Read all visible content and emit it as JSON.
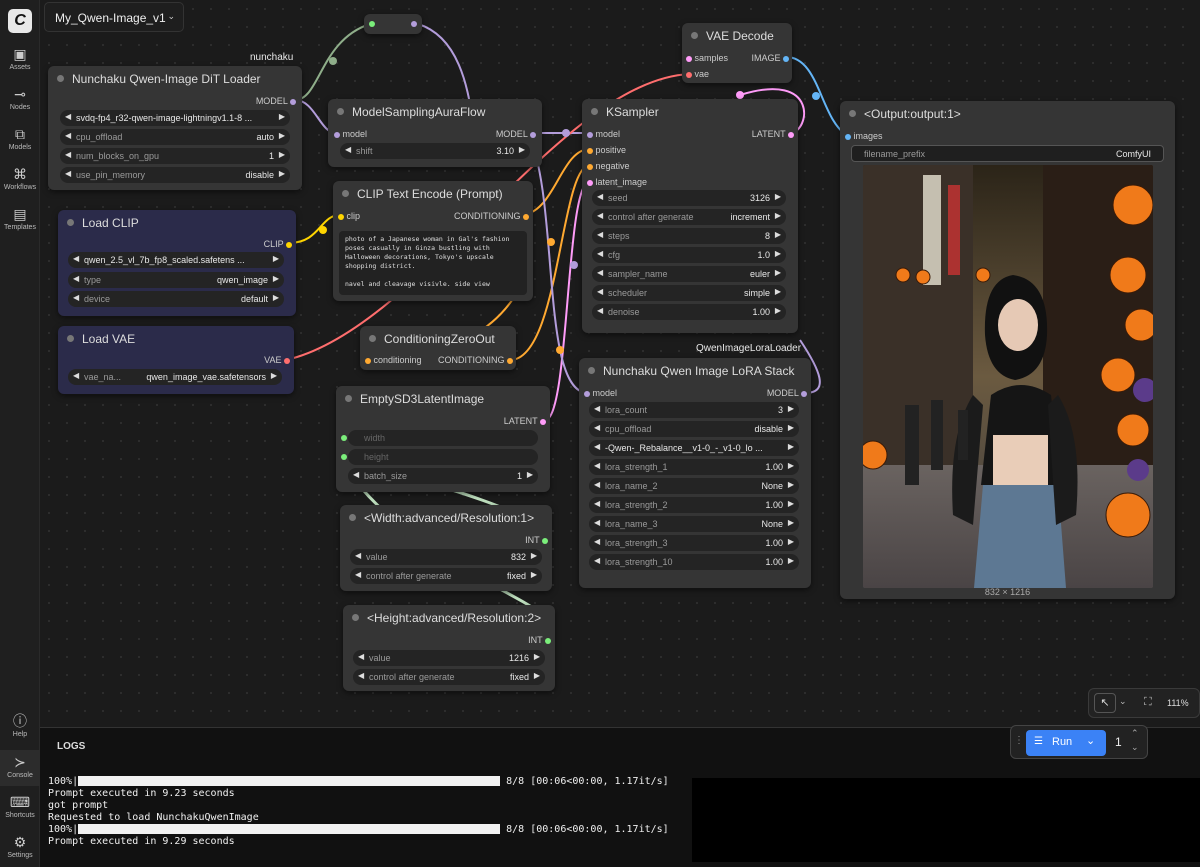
{
  "workflow_tab": {
    "title": "My_Qwen-Image_v1"
  },
  "sidebar": {
    "items": [
      {
        "label": "Assets"
      },
      {
        "label": "Nodes"
      },
      {
        "label": "Models"
      },
      {
        "label": "Workflows"
      },
      {
        "label": "Templates"
      }
    ],
    "bottom_items": [
      {
        "label": "Help"
      },
      {
        "label": "Console"
      },
      {
        "label": "Shortcuts"
      },
      {
        "label": "Settings"
      }
    ]
  },
  "group_labels": {
    "nunchaku": "nunchaku",
    "lora_loader": "QwenImageLoraLoader"
  },
  "nodes": {
    "dit_loader": {
      "title": "Nunchaku Qwen-Image DiT Loader",
      "out": "MODEL",
      "widgets": [
        {
          "label": "",
          "value": "svdq-fp4_r32-qwen-image-lightningv1.1-8 ..."
        },
        {
          "label": "cpu_offload",
          "value": "auto"
        },
        {
          "label": "num_blocks_on_gpu",
          "value": "1"
        },
        {
          "label": "use_pin_memory",
          "value": "disable"
        }
      ]
    },
    "load_clip": {
      "title": "Load CLIP",
      "out": "CLIP",
      "widgets": [
        {
          "label": "",
          "value": "qwen_2.5_vl_7b_fp8_scaled.safetens ..."
        },
        {
          "label": "type",
          "value": "qwen_image"
        },
        {
          "label": "device",
          "value": "default"
        }
      ]
    },
    "load_vae": {
      "title": "Load VAE",
      "out": "VAE",
      "widgets": [
        {
          "label": "vae_na...",
          "value": "qwen_image_vae.safetensors"
        }
      ]
    },
    "model_sampling": {
      "title": "ModelSamplingAuraFlow",
      "in": "model",
      "out": "MODEL",
      "widgets": [
        {
          "label": "shift",
          "value": "3.10"
        }
      ]
    },
    "clip_text": {
      "title": "CLIP Text Encode (Prompt)",
      "in": "clip",
      "out": "CONDITIONING",
      "text": "photo of a Japanese woman in Gal's fashion poses casually in Ginza bustling with Halloween decorations, Tokyo's upscale shopping district.\n\nnavel and cleavage visivle. side view"
    },
    "cond_zero": {
      "title": "ConditioningZeroOut",
      "in": "conditioning",
      "out": "CONDITIONING"
    },
    "empty_latent": {
      "title": "EmptySD3LatentImage",
      "out": "LATENT",
      "inputs": [
        "width",
        "height"
      ],
      "widgets": [
        {
          "label": "batch_size",
          "value": "1"
        }
      ]
    },
    "width_node": {
      "title": "<Width:advanced/Resolution:1>",
      "out": "INT",
      "widgets": [
        {
          "label": "value",
          "value": "832"
        },
        {
          "label": "control after generate",
          "value": "fixed"
        }
      ]
    },
    "height_node": {
      "title": "<Height:advanced/Resolution:2>",
      "out": "INT",
      "widgets": [
        {
          "label": "value",
          "value": "1216"
        },
        {
          "label": "control after generate",
          "value": "fixed"
        }
      ]
    },
    "vae_decode": {
      "title": "VAE Decode",
      "in1": "samples",
      "in2": "vae",
      "out": "IMAGE"
    },
    "ksampler": {
      "title": "KSampler",
      "inputs": [
        "model",
        "positive",
        "negative",
        "latent_image"
      ],
      "out": "LATENT",
      "widgets": [
        {
          "label": "seed",
          "value": "3126"
        },
        {
          "label": "control after generate",
          "value": "increment"
        },
        {
          "label": "steps",
          "value": "8"
        },
        {
          "label": "cfg",
          "value": "1.0"
        },
        {
          "label": "sampler_name",
          "value": "euler"
        },
        {
          "label": "scheduler",
          "value": "simple"
        },
        {
          "label": "denoise",
          "value": "1.00"
        }
      ]
    },
    "lora_stack": {
      "title": "Nunchaku Qwen Image LoRA Stack",
      "in": "model",
      "out": "MODEL",
      "widgets": [
        {
          "label": "lora_count",
          "value": "3"
        },
        {
          "label": "cpu_offload",
          "value": "disable"
        },
        {
          "label": "",
          "value": "-Qwen-_Rebalance__v1-0_-_v1-0_lo ..."
        },
        {
          "label": "lora_strength_1",
          "value": "1.00"
        },
        {
          "label": "lora_name_2",
          "value": "None"
        },
        {
          "label": "lora_strength_2",
          "value": "1.00"
        },
        {
          "label": "lora_name_3",
          "value": "None"
        },
        {
          "label": "lora_strength_3",
          "value": "1.00"
        },
        {
          "label": "lora_strength_10",
          "value": "1.00"
        }
      ]
    },
    "output": {
      "title": "<Output:output:1>",
      "in": "images",
      "widget": {
        "label": "filename_prefix",
        "value": "ComfyUI"
      },
      "image_size": "832 × 1216"
    }
  },
  "zoom": {
    "value": "111%"
  },
  "run": {
    "label": "Run",
    "batch": "1"
  },
  "logs": {
    "title": "LOGS",
    "lines": [
      {
        "prefix": "100%|",
        "bar": true,
        "suffix": " 8/8 [00:06<00:00,  1.17it/s]"
      },
      {
        "text": "Prompt executed in 9.23 seconds"
      },
      {
        "text": "got prompt"
      },
      {
        "text": "Requested to load NunchakuQwenImage"
      },
      {
        "prefix": "100%|",
        "bar": true,
        "suffix": " 8/8 [00:06<00:00,  1.17it/s]"
      },
      {
        "text": "Prompt executed in 9.29 seconds"
      }
    ]
  },
  "colors": {
    "model": "#b39ddb",
    "clip": "#ffd500",
    "vae": "#ff6e6e",
    "conditioning": "#ffa931",
    "latent": "#ff9cf9",
    "image": "#64b5f6",
    "int": "#7bee7b"
  }
}
